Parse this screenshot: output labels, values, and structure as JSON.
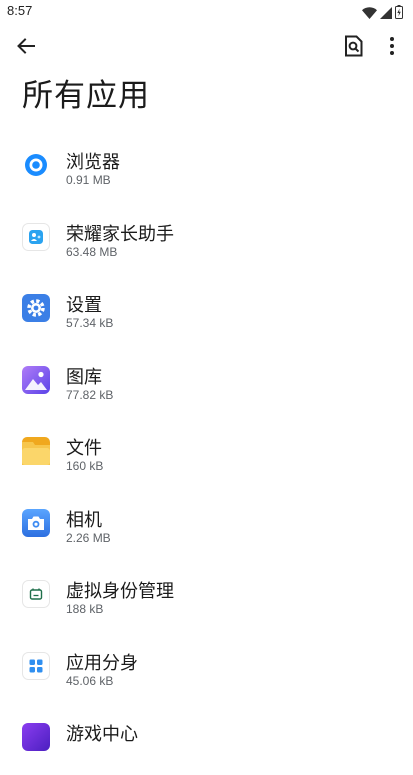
{
  "status_bar": {
    "time": "8:57"
  },
  "toolbar": {
    "back_icon": "arrow-back-icon",
    "search_icon": "search-document-icon",
    "more_icon": "more-vert-icon"
  },
  "page": {
    "title": "所有应用"
  },
  "apps": [
    {
      "name": "浏览器",
      "size": "0.91 MB",
      "icon": "browser-icon",
      "color": "#1a8cff"
    },
    {
      "name": "荣耀家长助手",
      "size": "63.48 MB",
      "icon": "parent-assistant-icon",
      "color": "#2aa3f0"
    },
    {
      "name": "设置",
      "size": "57.34 kB",
      "icon": "settings-icon",
      "color": "#3b7fe6"
    },
    {
      "name": "图库",
      "size": "77.82 kB",
      "icon": "gallery-icon",
      "color": "#7b5cf0"
    },
    {
      "name": "文件",
      "size": "160 kB",
      "icon": "files-icon",
      "color": "#f5b82e"
    },
    {
      "name": "相机",
      "size": "2.26 MB",
      "icon": "camera-icon",
      "color": "#3d8bf2"
    },
    {
      "name": "虚拟身份管理",
      "size": "188 kB",
      "icon": "virtual-identity-icon",
      "color": "#1f6f4a"
    },
    {
      "name": "应用分身",
      "size": "45.06 kB",
      "icon": "app-twin-icon",
      "color": "#2f8ff0"
    },
    {
      "name": "游戏中心",
      "size": "",
      "icon": "game-center-icon",
      "color": "#6a2bd9"
    }
  ]
}
